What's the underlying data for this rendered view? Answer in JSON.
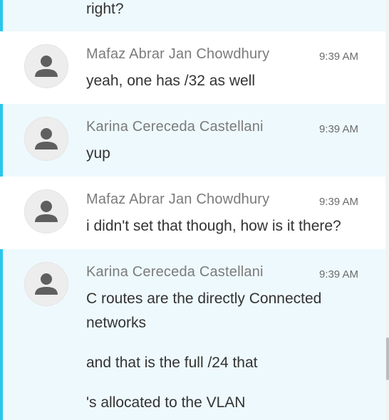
{
  "messages": [
    {
      "text_lines": [
        "right?"
      ]
    },
    {
      "author": "Mafaz Abrar Jan Chowdhury",
      "time": "9:39 AM",
      "avatar_icon": "user-avatar-icon",
      "text_lines": [
        "yeah, one has /32 as well"
      ]
    },
    {
      "author": "Karina Cereceda Castellani",
      "time": "9:39 AM",
      "avatar_icon": "user-avatar-icon",
      "text_lines": [
        "yup"
      ]
    },
    {
      "author": "Mafaz Abrar Jan Chowdhury",
      "time": "9:39 AM",
      "avatar_icon": "user-avatar-icon",
      "text_lines": [
        "i didn't set that though, how is it there?"
      ]
    },
    {
      "author": "Karina Cereceda Castellani",
      "time": "9:39 AM",
      "avatar_icon": "user-avatar-icon",
      "text_lines": [
        "C routes are the directly Connected",
        "networks",
        "and that is the full /24 that",
        "'s allocated to the VLAN"
      ]
    }
  ],
  "colors": {
    "highlight_bg": "#eef9fd",
    "highlight_border": "#29c6ee",
    "author": "#7b7b7b",
    "text": "#333333"
  }
}
